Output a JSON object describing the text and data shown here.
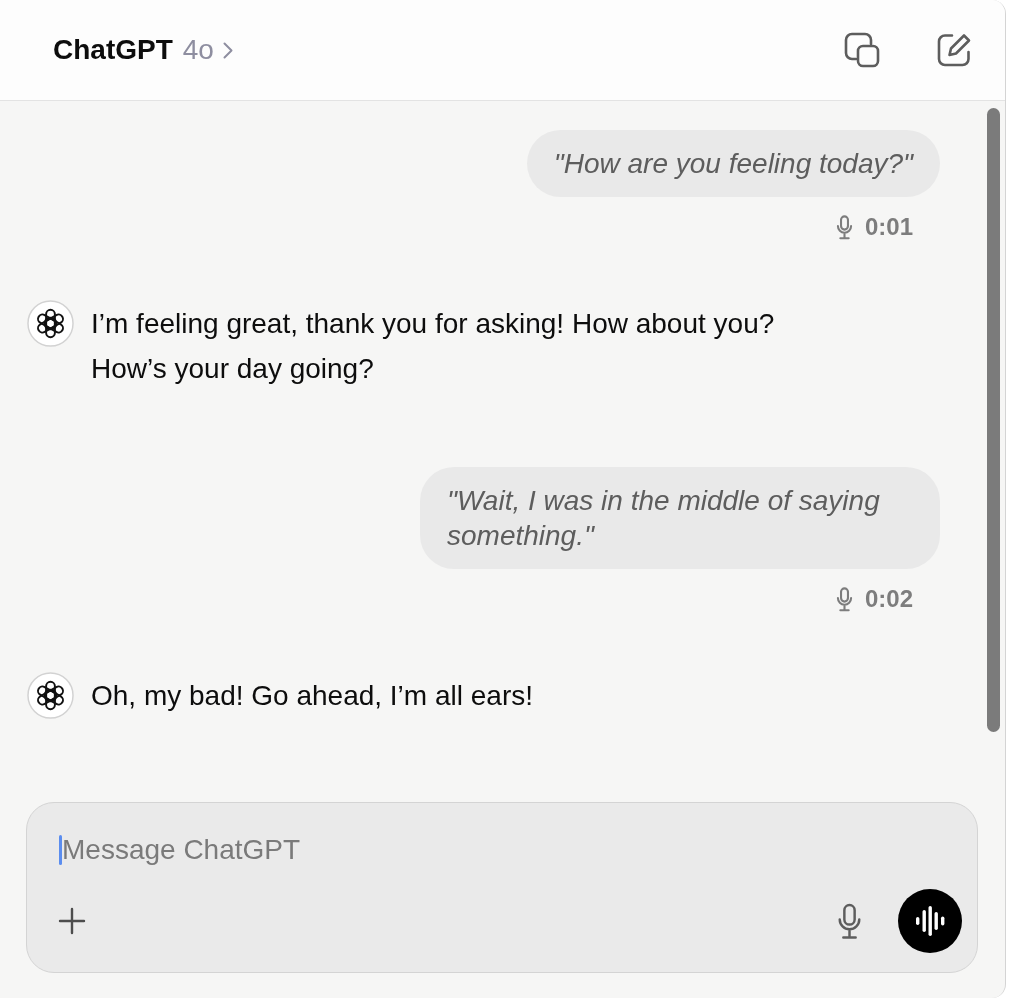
{
  "header": {
    "title": "ChatGPT",
    "model": "4o"
  },
  "messages": [
    {
      "kind": "user",
      "text": "\"How are you feeling today?\"",
      "duration": "0:01"
    },
    {
      "kind": "assistant",
      "text": "I’m feeling great, thank you for asking! How about you? How’s your day going?"
    },
    {
      "kind": "user",
      "text": "\"Wait, I was in the middle of saying something.\"",
      "duration": "0:02"
    },
    {
      "kind": "assistant",
      "text": "Oh, my bad! Go ahead, I’m all ears!"
    }
  ],
  "composer": {
    "placeholder": "Message ChatGPT",
    "focused": true
  }
}
